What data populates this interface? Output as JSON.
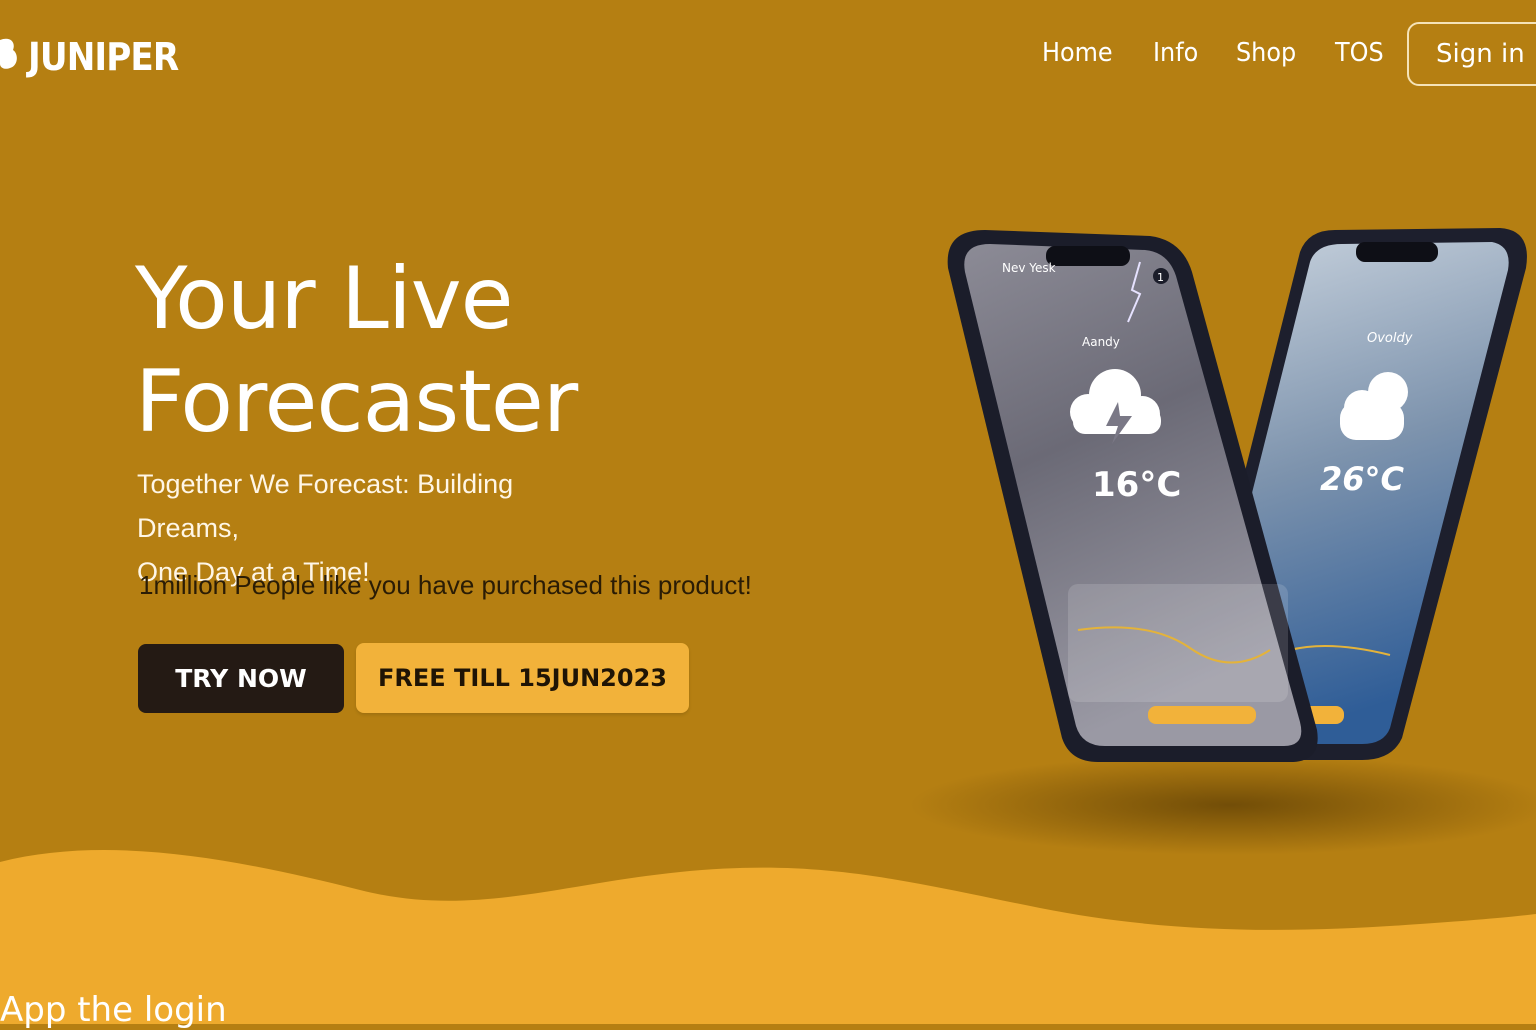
{
  "brand": {
    "name": "JUNIPER",
    "logo_icon": "cloud-logo-icon"
  },
  "nav": {
    "items": [
      "Home",
      "Info",
      "Shop",
      "TOS"
    ],
    "signin_label": "Sign in"
  },
  "hero": {
    "title_line1": "Your Live",
    "title_line2": "Forecaster",
    "subtitle_line1": "Together We Forecast: Building Dreams,",
    "subtitle_line2": "One Day at a Time!",
    "social_proof": "1million People like you have purchased this product!",
    "try_label": "TRY NOW",
    "free_label": "FREE TILL 15JUN2023"
  },
  "phones": {
    "front": {
      "header": "Nev Yesk",
      "condition": "Aandy",
      "temp": "16°C",
      "badge": "1",
      "icon": "thunderstorm-cloud-icon"
    },
    "back": {
      "condition": "Ovoldy",
      "temp": "26°C",
      "icon": "cloudy-icon"
    }
  },
  "bottom": {
    "heading": "App the login"
  },
  "colors": {
    "background": "#b57f12",
    "wave": "#eeaa2d",
    "accent": "#f2b23a",
    "dark_button": "#241a14"
  }
}
